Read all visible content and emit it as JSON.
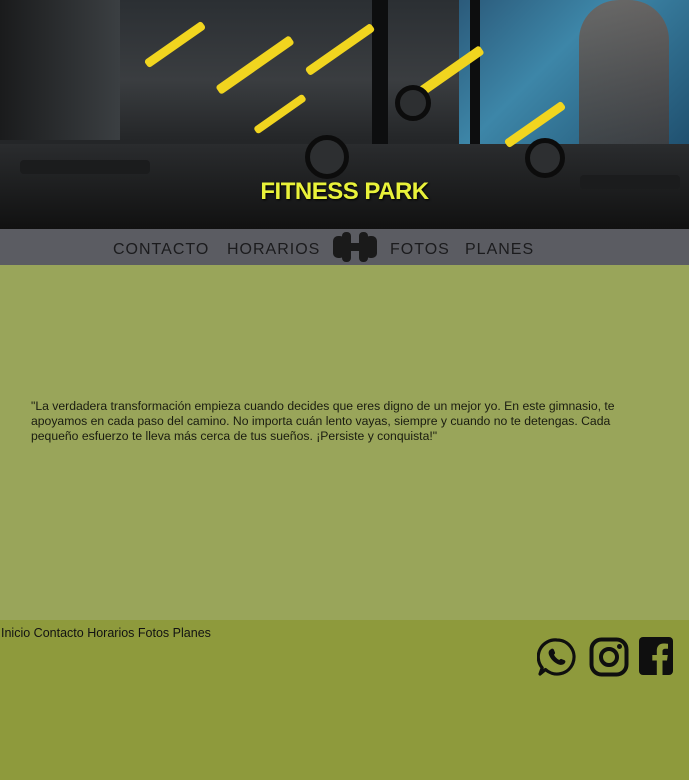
{
  "hero": {
    "title": "FITNESS PARK"
  },
  "nav": {
    "items": [
      {
        "label": "CONTACTO"
      },
      {
        "label": "HORARIOS"
      },
      {
        "label": "FOTOS"
      },
      {
        "label": "PLANES"
      }
    ],
    "logo_icon": "dumbbell-icon"
  },
  "main": {
    "quote": "\"La verdadera transformación empieza cuando decides que eres digno de un mejor yo. En este gimnasio, te apoyamos en cada paso del camino. No importa cuán lento vayas, siempre y cuando no te detengas. Cada pequeño esfuerzo te lleva más cerca de tus sueños. ¡Persiste y conquista!\""
  },
  "footer": {
    "links": [
      "Inicio",
      "Contacto",
      "Horarios",
      "Fotos",
      "Planes"
    ],
    "social_icons": [
      "whatsapp-icon",
      "instagram-icon",
      "facebook-icon"
    ]
  },
  "colors": {
    "hero_title": "#e9f23a",
    "nav_bg": "#5b5c62",
    "main_bg": "#99a55a",
    "footer_bg": "#8e9a3c"
  }
}
